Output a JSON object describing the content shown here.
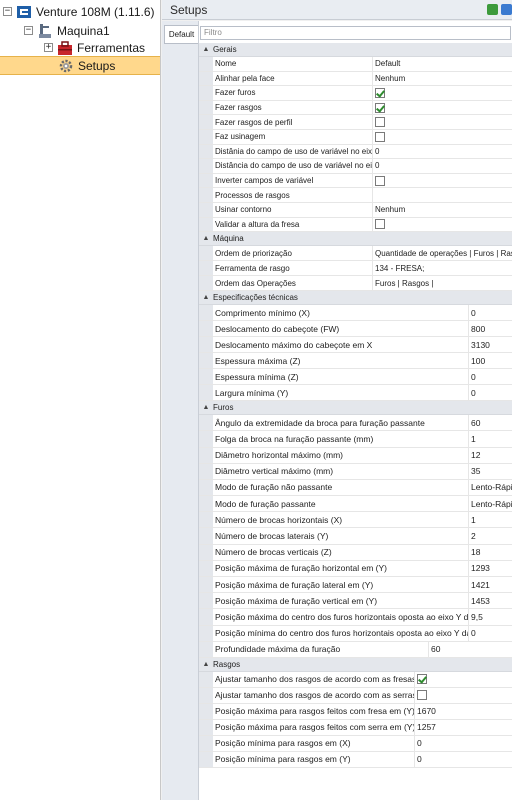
{
  "tree": {
    "root_label": "Venture 108M (1.11.6)",
    "machine_label": "Maquina1",
    "tools_label": "Ferramentas",
    "setups_label": "Setups"
  },
  "header": {
    "title": "Setups"
  },
  "tabs": {
    "default": "Default"
  },
  "grid": {
    "filter_placeholder": "Filtro"
  },
  "sections": [
    {
      "title": "Gerais",
      "cls": "g1",
      "rows": [
        {
          "name": "Nome",
          "value": "Default"
        },
        {
          "name": "Alinhar pela face",
          "value": "Nenhum"
        },
        {
          "name": "Fazer furos",
          "check": true
        },
        {
          "name": "Fazer rasgos",
          "check": true
        },
        {
          "name": "Fazer rasgos de perfil",
          "check": false
        },
        {
          "name": "Faz usinagem",
          "check": false
        },
        {
          "name": "Distânia do campo de uso de variável no eixo X",
          "value": "0"
        },
        {
          "name": "Distância do campo de uso de variável no eixo Y",
          "value": "0"
        },
        {
          "name": "Inverter campos de variável",
          "check": false
        },
        {
          "name": "Processos de rasgos",
          "value": ""
        },
        {
          "name": "Usinar contorno",
          "value": "Nenhum"
        },
        {
          "name": "Validar a altura da fresa",
          "check": false
        }
      ]
    },
    {
      "title": "Máquina",
      "cls": "g2",
      "rows": [
        {
          "name": "Ordem de priorização",
          "value": "Quantidade de operações | Furos | Rasgos"
        },
        {
          "name": "Ferramenta de rasgo",
          "value": "134 - FRESA;"
        },
        {
          "name": "Ordem das Operações",
          "value": "Furos | Rasgos |"
        }
      ]
    },
    {
      "title": "Especificações técnicas",
      "cls": "g3",
      "rows": [
        {
          "name": "Comprimento mínimo (X)",
          "value": "0"
        },
        {
          "name": "Deslocamento do cabeçote (FW)",
          "value": "800"
        },
        {
          "name": "Deslocamento máximo do cabeçote em X",
          "value": "3130"
        },
        {
          "name": "Espessura máxima (Z)",
          "value": "100"
        },
        {
          "name": "Espessura mínima (Z)",
          "value": "0"
        },
        {
          "name": "Largura mínima (Y)",
          "value": "0"
        }
      ]
    },
    {
      "title": "Furos",
      "cls": "g4",
      "rows": [
        {
          "name": "Ângulo da extremidade da broca para furação passante",
          "value": "60"
        },
        {
          "name": "Folga da broca na furação passante (mm)",
          "value": "1"
        },
        {
          "name": "Diâmetro horizontal máximo (mm)",
          "value": "12"
        },
        {
          "name": "Diâmetro vertical máximo (mm)",
          "value": "35"
        },
        {
          "name": "Modo de furação não passante",
          "value": "Lento-Rápido"
        },
        {
          "name": "Modo de furação passante",
          "value": "Lento-Rápido"
        },
        {
          "name": "Número de brocas horizontais (X)",
          "value": "1"
        },
        {
          "name": "Número de brocas laterais (Y)",
          "value": "2"
        },
        {
          "name": "Número de brocas verticais (Z)",
          "value": "18"
        },
        {
          "name": "Posição máxima de furação horizontal em (Y)",
          "value": "1293"
        },
        {
          "name": "Posição máxima de furação lateral em (Y)",
          "value": "1421"
        },
        {
          "name": "Posição máxima de furação vertical em (Y)",
          "value": "1453"
        },
        {
          "name": "Posição máxima do centro dos furos horizontais oposta ao eixo Y da fa",
          "value": "9,5"
        },
        {
          "name": "Posição mínima do centro dos furos horizontais oposta ao eixo Y da fa",
          "value": "0"
        },
        {
          "name": "Profundidade máxima da furação",
          "value": "60",
          "narrow": true
        }
      ]
    },
    {
      "title": "Rasgos",
      "cls": "g5",
      "rows": [
        {
          "name": "Ajustar tamanho dos rasgos de acordo com as fresas",
          "check": true
        },
        {
          "name": "Ajustar tamanho dos rasgos de acordo com as serras",
          "check": false
        },
        {
          "name": "Posição máxima para rasgos feitos com fresa em (Y)",
          "value": "1670"
        },
        {
          "name": "Posição máxima para rasgos feitos com serra em (Y)",
          "value": "1257"
        },
        {
          "name": "Posição mínima para rasgos em (X)",
          "value": "0"
        },
        {
          "name": "Posição mínima para rasgos em (Y)",
          "value": "0"
        }
      ]
    }
  ]
}
